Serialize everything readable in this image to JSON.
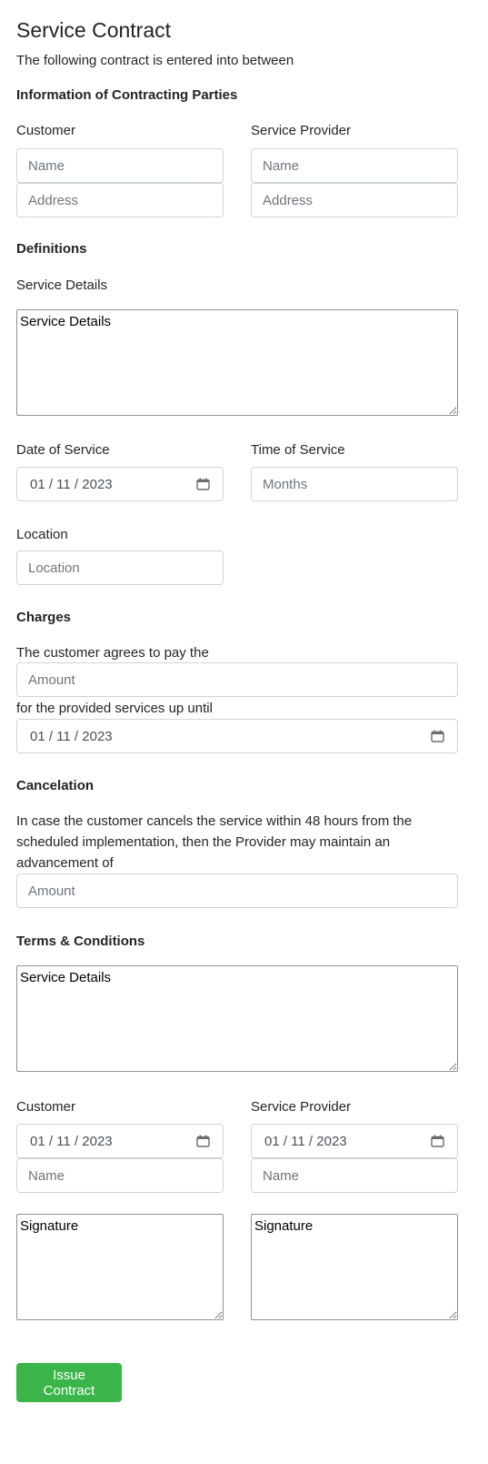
{
  "page": {
    "title": "Service Contract",
    "intro": "The following contract is entered into between"
  },
  "parties": {
    "heading": "Information of Contracting Parties",
    "customer": {
      "label": "Customer",
      "name_placeholder": "Name",
      "address_placeholder": "Address"
    },
    "provider": {
      "label": "Service Provider",
      "name_placeholder": "Name",
      "address_placeholder": "Address"
    }
  },
  "definitions": {
    "heading": "Definitions",
    "service_details_label": "Service Details",
    "service_details_placeholder": "Service Details",
    "date_of_service_label": "Date of Service",
    "date_of_service_value": "01 / 11 / 2023",
    "time_of_service_label": "Time of Service",
    "time_of_service_placeholder": "Months",
    "location_label": "Location",
    "location_placeholder": "Location"
  },
  "charges": {
    "heading": "Charges",
    "text_before": "The customer agrees to pay the",
    "amount_placeholder": "Amount",
    "text_after": "for the provided services up until",
    "until_date_value": "01 / 11 / 2023"
  },
  "cancelation": {
    "heading": "Cancelation",
    "text": "In case the customer cancels the service within 48 hours from the scheduled implementation, then the Provider may maintain an advancement of",
    "amount_placeholder": "Amount"
  },
  "terms": {
    "heading": "Terms & Conditions",
    "placeholder": "Service Details"
  },
  "signatures": {
    "customer": {
      "label": "Customer",
      "date_value": "01 / 11 / 2023",
      "name_placeholder": "Name",
      "signature_placeholder": "Signature"
    },
    "provider": {
      "label": "Service Provider",
      "date_value": "01 / 11 / 2023",
      "name_placeholder": "Name",
      "signature_placeholder": "Signature"
    }
  },
  "actions": {
    "issue_label": "Issue Contract"
  },
  "colors": {
    "button_green": "#3bb54a",
    "text": "#212529",
    "placeholder": "#6c757d",
    "input_border": "#ced4da"
  }
}
